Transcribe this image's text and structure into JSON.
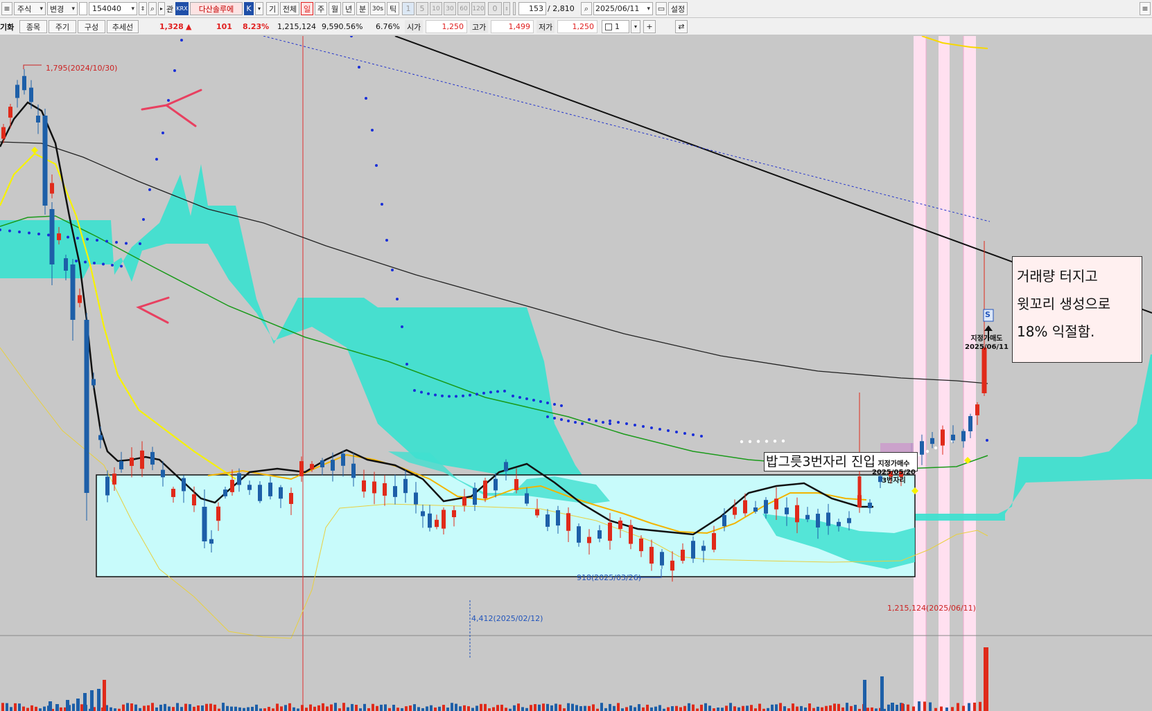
{
  "toolbar1": {
    "market": "주식",
    "change_label": "변경",
    "code": "154040",
    "related": "관",
    "exchange_badge": "KRX",
    "stock_name": "다산솔루에",
    "k_badge": "K",
    "gi": "기",
    "all": "전체",
    "periods": [
      "일",
      "주",
      "월",
      "년",
      "분",
      "30s",
      "틱"
    ],
    "minute_steps": [
      "1",
      "5",
      "10",
      "30",
      "60",
      "120"
    ],
    "zero": "0",
    "bars_shown": "153",
    "bars_total": "/ 2,810",
    "date": "2025/06/11",
    "settings": "설정"
  },
  "toolbar2": {
    "left_label": "기화",
    "tabs": [
      "종목",
      "주기",
      "구성",
      "추세선"
    ],
    "price": "1,328",
    "arrow": "▲",
    "change": "101",
    "change_pct": "8.23%",
    "volume": "1,215,124",
    "volume_pct": "9,590.56%",
    "turnover_pct": "6.76%",
    "open_label": "시가",
    "open": "1,250",
    "high_label": "고가",
    "high": "1,499",
    "low_label": "저가",
    "low": "1,250",
    "count": "1"
  },
  "annotations": {
    "high_marker": "1,795(2024/10/30)",
    "low_marker": "918(2025/03/26)",
    "vol_max_marker": "4,412(2025/02/12)",
    "vol_last_marker": "1,215,124(2025/06/11)",
    "entry_box": "밥그릇3번자리 진입",
    "buy_marker_l1": "지정가매수",
    "buy_marker_l2": "2025/05/20",
    "buy_marker_l3": "3번자리",
    "sell_marker_l1": "지정가매도",
    "sell_marker_l2": "2025/06/11",
    "sell_badge": "S",
    "note_lines": [
      "거래량 터지고",
      "윗꼬리 생성으로",
      "18% 익절함."
    ]
  },
  "colors": {
    "background": "#c8c8c8",
    "up_candle": "#e02a1a",
    "down_candle": "#1d5fa8",
    "cloud": "#40e0d0",
    "box_fill": "#c8fbfb",
    "ma_yellow": "#f7f200",
    "ma_green": "#1a9a1a",
    "highlight_pink": "#ffe0f0"
  }
}
